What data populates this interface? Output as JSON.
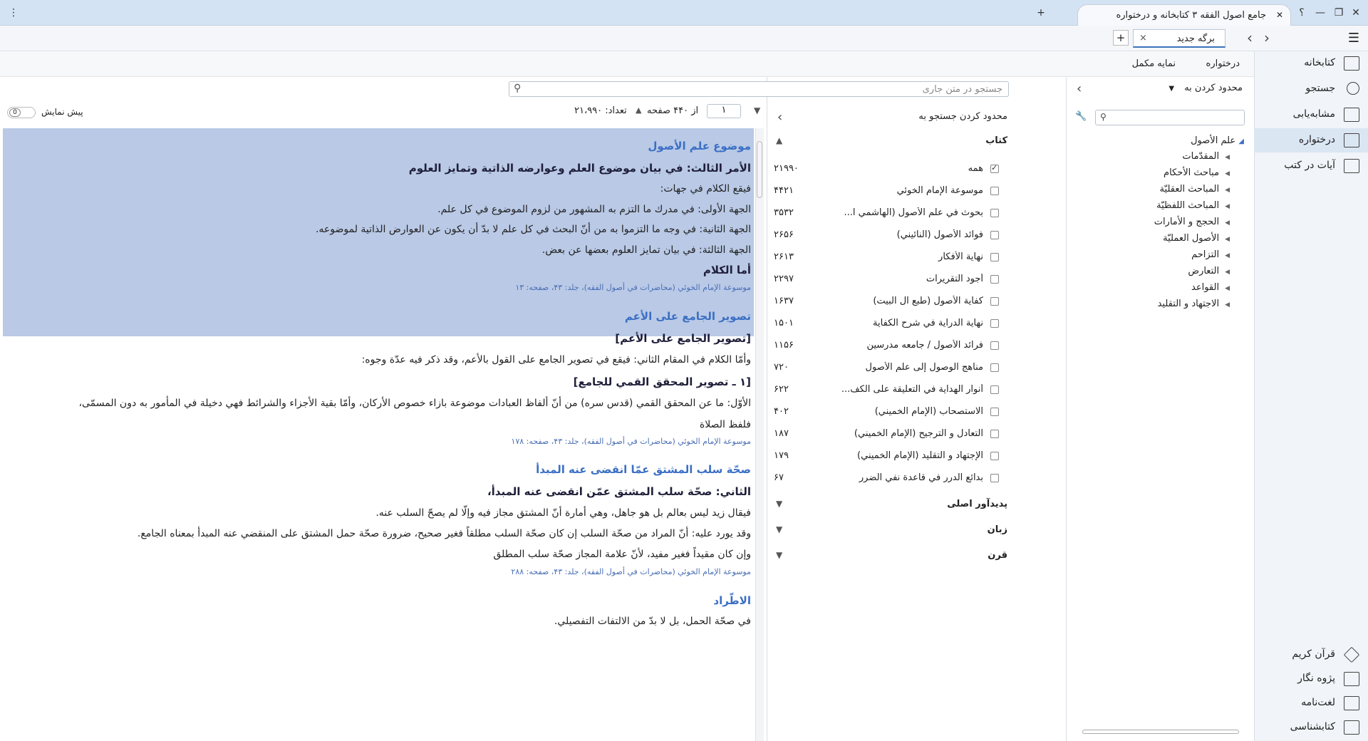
{
  "window": {
    "title": "جامع اصول الفقه ۳ کتابخانه و درختواره",
    "new_tab": "+",
    "help": "؟",
    "minimize": "—",
    "restore": "❐",
    "close": "✕",
    "menu": "⋮"
  },
  "doc_tabs": {
    "active_label": "برگه جدید",
    "close_glyph": "×",
    "add_glyph": "+",
    "prev_glyph": "‹",
    "next_glyph": "›",
    "hamburger": "☰"
  },
  "subtabs": [
    "درختواره",
    "نمایه مکمل"
  ],
  "sidebar": {
    "top_items": [
      {
        "label": "کتابخانه",
        "icon": "library-icon",
        "active": false
      },
      {
        "label": "جستجو",
        "icon": "search-icon",
        "active": false
      },
      {
        "label": "مشابه‌یابی",
        "icon": "similar-icon",
        "active": false
      },
      {
        "label": "درختواره",
        "icon": "tree-icon",
        "active": true
      },
      {
        "label": "آیات در کتب",
        "icon": "verses-icon",
        "active": false
      }
    ],
    "bottom_items": [
      {
        "label": "قرآن کریم",
        "icon": "quran-icon"
      },
      {
        "label": "پژوه نگار",
        "icon": "notes-icon"
      },
      {
        "label": "لغت‌نامه",
        "icon": "dictionary-icon"
      },
      {
        "label": "کتابشناسی",
        "icon": "bibliography-icon"
      }
    ]
  },
  "tree": {
    "limit_label": "محدود کردن به",
    "root": "علم الأصول",
    "children": [
      "المقدّمات",
      "مباحث الأحكام",
      "المباحث العقليّة",
      "المباحث اللفظيّة",
      "الحجج و الأمارات",
      "الأصول العمليّة",
      "التزاحم",
      "التعارض",
      "القواعد",
      "الاجتهاد و التقليد"
    ]
  },
  "filter": {
    "title": "محدود کردن جستجو به",
    "books_header": "کتاب",
    "books": [
      {
        "name": "همه",
        "count": "۲۱۹۹۰",
        "checked": true
      },
      {
        "name": "موسوعة الإمام الخوئي",
        "count": "۴۴۲۱",
        "checked": false
      },
      {
        "name": "بحوث في علم الأصول (الهاشمي ا...",
        "count": "۳۵۳۲",
        "checked": false
      },
      {
        "name": "فوائد الأصول (النائيني)",
        "count": "۲۶۵۶",
        "checked": false
      },
      {
        "name": "نهاية الأفكار",
        "count": "۲۶۱۳",
        "checked": false
      },
      {
        "name": "أجود التقريرات",
        "count": "۲۲۹۷",
        "checked": false
      },
      {
        "name": "كفاية الأصول (طبع آل البيت)",
        "count": "۱۶۳۷",
        "checked": false
      },
      {
        "name": "نهاية الدراية في شرح الكفاية",
        "count": "۱۵۰۱",
        "checked": false
      },
      {
        "name": "فرائد الأصول / جامعه مدرسين",
        "count": "۱۱۵۶",
        "checked": false
      },
      {
        "name": "مناهج الوصول إلى علم الأصول",
        "count": "۷۲۰",
        "checked": false
      },
      {
        "name": "أنوار الهداية في التعليقة على الكف...",
        "count": "۶۲۲",
        "checked": false
      },
      {
        "name": "الاستصحاب (الإمام الخميني)",
        "count": "۴۰۲",
        "checked": false
      },
      {
        "name": "التعادل و الترجيح (الإمام الخميني)",
        "count": "۱۸۷",
        "checked": false
      },
      {
        "name": "الإجتهاد و التقليد (الإمام الخميني)",
        "count": "۱۷۹",
        "checked": false
      },
      {
        "name": "بدائع الدرر في قاعدة نفي الضرر",
        "count": "۶۷",
        "checked": false
      }
    ],
    "sections": [
      "پدیدآور اصلی",
      "زبان",
      "قرن"
    ]
  },
  "content": {
    "search_placeholder": "جستجو در متن جاری",
    "page_value": "۱",
    "page_total": "از ۴۴۰ صفحه",
    "count_label": "تعداد: ۲۱،۹۹۰",
    "preview_label": "پیش نمایش",
    "preview_value": "0",
    "blocks": [
      {
        "cls": "heading",
        "text": "موضوع علم الأصول"
      },
      {
        "cls": "bold",
        "text": "الأمر الثالث: في بيان موضوع العلم وعوارضه الذاتية وتمايز العلوم"
      },
      {
        "cls": "body",
        "text": "فيقع الكلام في جهات:"
      },
      {
        "cls": "body",
        "text": "الجهة الأولى: في مدرك ما التزم به المشهور من لزوم الموضوع في كل علم."
      },
      {
        "cls": "body",
        "text": "الجهة الثانية: في وجه ما التزموا به من أنّ البحث في كل علم لا بدّ أن يكون عن العوارض الذاتية لموضوعه."
      },
      {
        "cls": "body",
        "text": "الجهة الثالثة: في بيان تمايز العلوم بعضها عن بعض."
      },
      {
        "cls": "bold",
        "text": "أما الكلام"
      },
      {
        "cls": "src",
        "text": "موسوعة الإمام الخوئي (محاضرات في أصول الفقه)، جلد: ۴۳، صفحه: ۱۳"
      },
      {
        "cls": "heading",
        "text": "تصوير الجامع على الأعم"
      },
      {
        "cls": "bold",
        "text": "[تصوير الجامع على الأعم]"
      },
      {
        "cls": "body",
        "text": "وأمّا الكلام في المقام الثاني: فيقع في تصوير الجامع على القول بالأعم، وقد ذكر فيه عدّة وجوه:"
      },
      {
        "cls": "bold",
        "text": "[١ ـ تصوير المحقق القمي للجامع]"
      },
      {
        "cls": "body",
        "text": "الأوّل: ما عن المحقق القمي (قدس سره) من أنّ ألفاظ العبادات موضوعة بازاء خصوص الأركان، وأمّا بقية الأجزاء والشرائط فهي دخيلة في المأمور به دون المسمّى،"
      },
      {
        "cls": "body",
        "text": "فلفظ الصلاة"
      },
      {
        "cls": "src",
        "text": "موسوعة الإمام الخوئي (محاضرات في أصول الفقه)، جلد: ۴۳، صفحه: ۱۷۸"
      },
      {
        "cls": "heading",
        "text": "صحّة سلب المشتق عمّا انقضى عنه المبدأ"
      },
      {
        "cls": "bold",
        "text": "الثاني: صحّة سلب المشتق عمّن انقضى عنه المبدأ،"
      },
      {
        "cls": "body",
        "text": "فيقال زيد ليس بعالم بل هو جاهل، وهي أمارة أنّ المشتق مجاز فيه وإلّا لم يصحّ السلب عنه."
      },
      {
        "cls": "body",
        "text": "وقد يورد عليه: أنّ المراد من صحّة السلب إن كان صحّة السلب مطلقاً فغير صحيح، ضرورة صحّة حمل المشتق على المنقضي عنه المبدأ بمعناه الجامع."
      },
      {
        "cls": "body",
        "text": "وإن كان مقيداً فغير مفيد، لأنّ علامة المجاز صحّة سلب المطلق"
      },
      {
        "cls": "src",
        "text": "موسوعة الإمام الخوئي (محاضرات في أصول الفقه)، جلد: ۴۳، صفحه: ۲۸۸"
      },
      {
        "cls": "heading",
        "text": "الاطّراد"
      },
      {
        "cls": "body",
        "text": "في صحّة الحمل، بل لا بدّ من الالتفات التفصيلي."
      }
    ]
  }
}
